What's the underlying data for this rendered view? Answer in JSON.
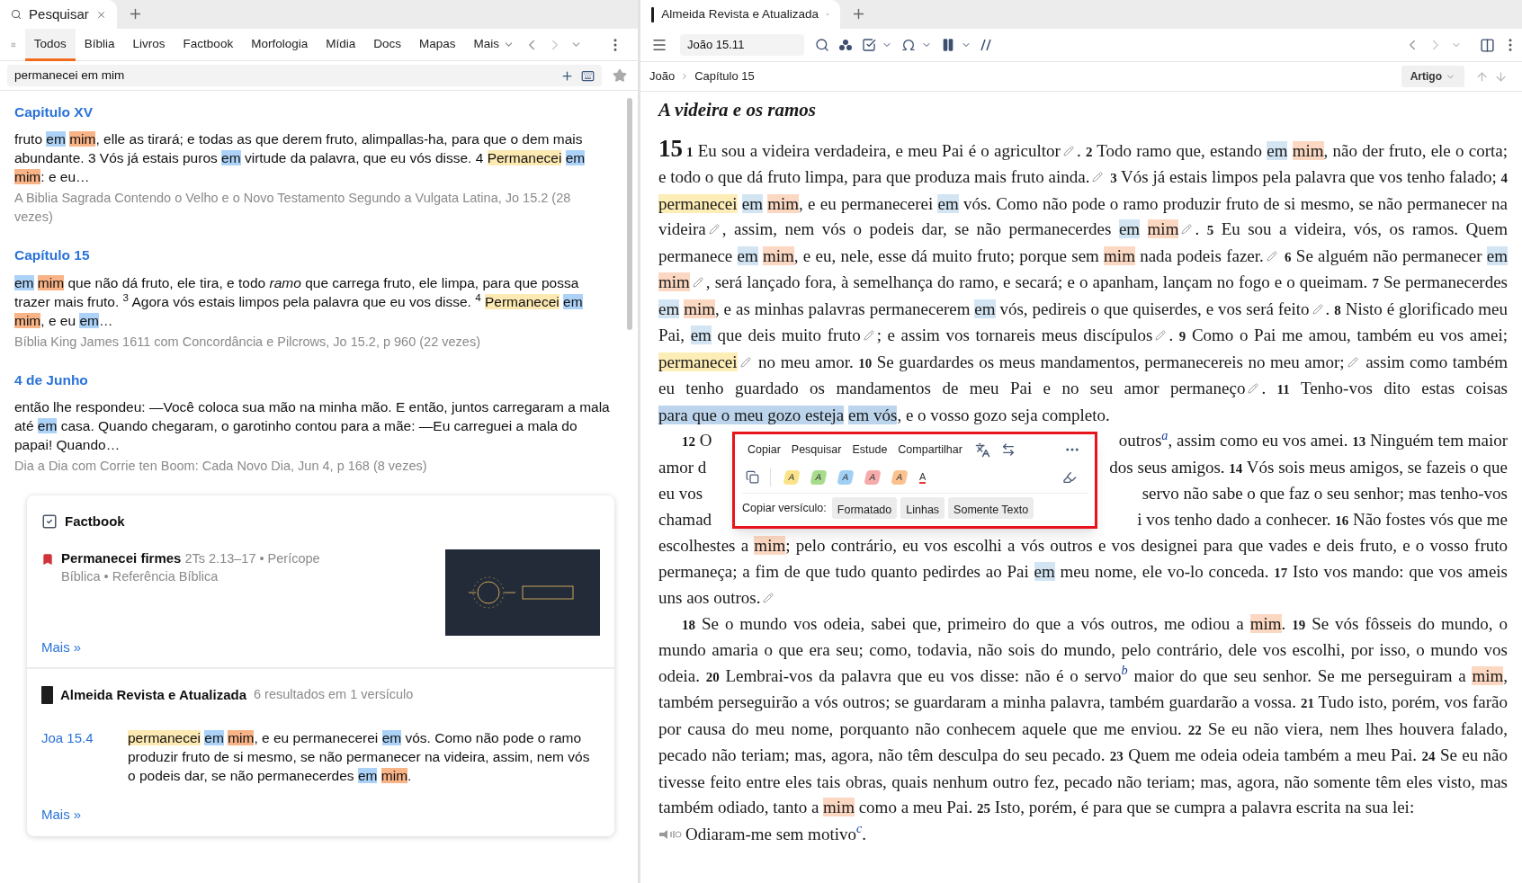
{
  "left_tab": {
    "label": "Pesquisar"
  },
  "search_tabs": [
    {
      "label": "Todos",
      "selected": true,
      "dropdown": false
    },
    {
      "label": "Bíblia",
      "selected": false,
      "dropdown": false
    },
    {
      "label": "Livros",
      "selected": false,
      "dropdown": false
    },
    {
      "label": "Factbook",
      "selected": false,
      "dropdown": false
    },
    {
      "label": "Morfologia",
      "selected": false,
      "dropdown": false
    },
    {
      "label": "Mídia",
      "selected": false,
      "dropdown": false
    },
    {
      "label": "Docs",
      "selected": false,
      "dropdown": false
    },
    {
      "label": "Mapas",
      "selected": false,
      "dropdown": false
    },
    {
      "label": "Mais",
      "selected": false,
      "dropdown": true
    }
  ],
  "query": "permanecei em mim",
  "results": [
    {
      "heading": "Capitulo XV",
      "segments": [
        {
          "kind": "text",
          "text": "fruto "
        },
        {
          "kind": "mark",
          "words": [
            {
              "text": "em",
              "color": "#acd2f8"
            },
            {
              "text": "mim",
              "color": "#f8b386"
            }
          ]
        },
        {
          "kind": "text",
          "text": ", elle as tirará; e todas as que derem fruto, alimpallas-ha, para que o dem mais abundante. 3 Vós já estais puros "
        },
        {
          "kind": "mark",
          "words": [
            {
              "text": "em",
              "color": "#acd2f8"
            }
          ]
        },
        {
          "kind": "text",
          "text": " virtude da palavra, que eu vós disse. 4 "
        },
        {
          "kind": "mark",
          "words": [
            {
              "text": "Permanecei",
              "color": "#fde9b2"
            },
            {
              "text": "em",
              "color": "#acd2f8"
            },
            {
              "text": "mim",
              "color": "#f8b386"
            }
          ]
        },
        {
          "kind": "text",
          "text": ": e eu…"
        }
      ],
      "source": "A Biblia Sagrada Contendo o Velho e o Novo Testamento Segundo a Vulgata Latina, Jo 15.2 (28 vezes)"
    },
    {
      "heading": "Capítulo 15",
      "segments": [
        {
          "kind": "mark",
          "words": [
            {
              "text": "em",
              "color": "#acd2f8"
            },
            {
              "text": "mim",
              "color": "#f8b386"
            }
          ]
        },
        {
          "kind": "text",
          "text": " que não dá fruto, ele tira, e todo *ramo* que carrega fruto, ele limpa, para que possa trazer mais fruto. $^{3}$ Agora vós estais limpos pela palavra que eu vos disse. $^{4}$ "
        },
        {
          "kind": "mark",
          "words": [
            {
              "text": "Permanecei",
              "color": "#fde9b2"
            },
            {
              "text": "em",
              "color": "#acd2f8"
            },
            {
              "text": "mim",
              "color": "#f8b386"
            }
          ]
        },
        {
          "kind": "text",
          "text": ", e eu "
        },
        {
          "kind": "mark",
          "words": [
            {
              "text": "em",
              "color": "#acd2f8"
            }
          ]
        },
        {
          "kind": "text",
          "text": "…"
        }
      ],
      "source": "Bíblia King James 1611 com Concordância e Pilcrows, Jo 15.2, p 960 (22 vezes)"
    },
    {
      "heading": "4 de Junho",
      "segments": [
        {
          "kind": "text",
          "text": "então lhe respondeu: —Você coloca sua mão na minha mão. E então, juntos carregaram a mala até "
        },
        {
          "kind": "mark",
          "words": [
            {
              "text": "em",
              "color": "#acd2f8"
            }
          ]
        },
        {
          "kind": "text",
          "text": " casa. Quando chegaram, o garotinho contou para a mãe: —Eu carreguei a mala do papai! Quando…"
        }
      ],
      "source": "Dia a Dia com Corrie ten Boom: Cada Novo Dia, Jun 4, p 168 (8 vezes)"
    }
  ],
  "factbook": {
    "title": "Factbook",
    "entry_title": "Permanecei firmes",
    "entry_meta": "2Ts 2.13–17 • Perícope Bíblica • Referência Bíblica",
    "more": "Mais »"
  },
  "bible_result": {
    "title": "Almeida Revista e Atualizada",
    "meta": "6 resultados em 1 versículo",
    "reference": "Joa 15.4",
    "segments": [
      {
        "kind": "mark",
        "words": [
          {
            "text": "permanecei",
            "color": "#fde9b2"
          },
          {
            "text": "em",
            "color": "#acd2f8"
          },
          {
            "text": "mim",
            "color": "#f8b386"
          }
        ]
      },
      {
        "kind": "text",
        "text": ", e eu permanecerei "
      },
      {
        "kind": "mark",
        "words": [
          {
            "text": "em",
            "color": "#acd2f8"
          }
        ]
      },
      {
        "kind": "text",
        "text": " vós. Como não pode o ramo produzir fruto de si mesmo, se não permanecer na videira, assim, nem vós o podeis dar, se não permanecerdes "
      },
      {
        "kind": "mark",
        "words": [
          {
            "text": "em",
            "color": "#acd2f8"
          },
          {
            "text": "mim",
            "color": "#f8b386"
          }
        ]
      },
      {
        "kind": "text",
        "text": "."
      }
    ],
    "more": "Mais »"
  },
  "right_tab": {
    "title": "Almeida Revista e Atualizada"
  },
  "reference_field": "João 15.11",
  "breadcrumb": [
    "João",
    "Capítulo 15"
  ],
  "view_button": "Artigo",
  "heading": "A videira e os ramos",
  "paragraph_1": [
    {
      "kind": "chapter",
      "text": "15"
    },
    {
      "kind": "text",
      "text": "**1** Eu sou a videira verdadeira, e meu Pai é o agricultor"
    },
    {
      "kind": "note"
    },
    {
      "kind": "text",
      "text": ". **2** Todo ramo que, estando "
    },
    {
      "kind": "mark",
      "words": [
        {
          "text": "em",
          "color": "#d3e5f3"
        },
        {
          "text": "mim",
          "color": "#fcd8c2"
        }
      ]
    },
    {
      "kind": "text",
      "text": ", não der fruto, ele o corta; e todo o que dá fruto limpa, para que produza mais fruto ainda."
    },
    {
      "kind": "note"
    },
    {
      "kind": "text",
      "text": " **3** Vós já estais limpos pela palavra que vos tenho falado; **4** "
    },
    {
      "kind": "mark",
      "words": [
        {
          "text": "permanecei",
          "color": "#fdedb6"
        },
        {
          "text": "em",
          "color": "#d3e5f3"
        },
        {
          "text": "mim",
          "color": "#fcd8c2"
        }
      ]
    },
    {
      "kind": "text",
      "text": ", e eu permanecerei "
    },
    {
      "kind": "mark",
      "words": [
        {
          "text": "em",
          "color": "#d3e5f3"
        }
      ]
    },
    {
      "kind": "text",
      "text": " vós. Como não pode o ramo produzir fruto de si mesmo, se não permanecer na videira"
    },
    {
      "kind": "note"
    },
    {
      "kind": "text",
      "text": ", assim, nem vós o podeis dar, se não permanecerdes "
    },
    {
      "kind": "mark",
      "words": [
        {
          "text": "em",
          "color": "#d3e5f3"
        },
        {
          "text": "mim",
          "color": "#fcd8c2"
        }
      ]
    },
    {
      "kind": "note"
    },
    {
      "kind": "text",
      "text": ". **5** Eu sou a videira, vós, os ramos. Quem permanece "
    },
    {
      "kind": "mark",
      "words": [
        {
          "text": "em",
          "color": "#d3e5f3"
        },
        {
          "text": "mim",
          "color": "#fcd8c2"
        }
      ]
    },
    {
      "kind": "text",
      "text": ", e eu, nele, esse dá muito fruto; porque sem "
    },
    {
      "kind": "mark",
      "words": [
        {
          "text": "mim",
          "color": "#fcd8c2"
        }
      ]
    },
    {
      "kind": "text",
      "text": " nada podeis fazer."
    },
    {
      "kind": "note"
    },
    {
      "kind": "text",
      "text": " **6** Se alguém não permanecer "
    },
    {
      "kind": "mark",
      "words": [
        {
          "text": "em",
          "color": "#d3e5f3"
        },
        {
          "text": "mim",
          "color": "#fcd8c2"
        }
      ]
    },
    {
      "kind": "note"
    },
    {
      "kind": "text",
      "text": ", será lançado fora, à semelhança do ramo, e secará; e o apanham, lançam no fogo e o queimam. **7** Se permanecerdes "
    },
    {
      "kind": "mark",
      "words": [
        {
          "text": "em",
          "color": "#d3e5f3"
        },
        {
          "text": "mim",
          "color": "#fcd8c2"
        }
      ]
    },
    {
      "kind": "text",
      "text": ", e as minhas palavras permanecerem "
    },
    {
      "kind": "mark",
      "words": [
        {
          "text": "em",
          "color": "#d3e5f3"
        }
      ]
    },
    {
      "kind": "text",
      "text": " vós, pedireis o que quiserdes, e vos será feito"
    },
    {
      "kind": "note"
    },
    {
      "kind": "text",
      "text": ". **8** Nisto é glorificado meu Pai, "
    },
    {
      "kind": "mark",
      "words": [
        {
          "text": "em",
          "color": "#d3e5f3"
        }
      ]
    },
    {
      "kind": "text",
      "text": " que deis muito fruto"
    },
    {
      "kind": "note"
    },
    {
      "kind": "text",
      "text": "; e assim vos tornareis meus discípulos"
    },
    {
      "kind": "note"
    },
    {
      "kind": "text",
      "text": ". **9** Como o Pai me amou, também eu vos amei; "
    },
    {
      "kind": "mark",
      "words": [
        {
          "text": "permanecei",
          "color": "#fdedb6"
        }
      ]
    },
    {
      "kind": "note"
    },
    {
      "kind": "text",
      "text": " no meu amor. **10** Se guardardes os meus mandamentos, permanecereis no meu amor;"
    },
    {
      "kind": "note"
    },
    {
      "kind": "text",
      "text": " assim como também eu tenho guardado os mandamentos de meu Pai e no seu amor permaneço"
    },
    {
      "kind": "note"
    },
    {
      "kind": "text",
      "text": ". **11** Tenho-vos dito estas coisas "
    },
    {
      "kind": "mark",
      "words": [
        {
          "text": "para que o meu gozo esteja",
          "color": "#bcd5ec"
        },
        {
          "text": "em vós",
          "color": "#bcd5ec"
        }
      ]
    },
    {
      "kind": "text",
      "text": ", e o vosso gozo seja completo."
    }
  ],
  "covered_lines": [
    {
      "left": "**12** O",
      "right": "outros$^{a}$, assim como eu vos amei. **13** Ninguém tem maior"
    },
    {
      "left": "amor d",
      "right": "dos seus amigos. **14** Vós sois meus amigos, se fazeis o que"
    },
    {
      "left": "eu vos",
      "right": "servo não sabe o que faz o seu senhor; mas tenho-vos"
    },
    {
      "left": "chamad",
      "right": "i vos tenho dado a conhecer. **16** Não fostes vós que me"
    }
  ],
  "paragraph_2": [
    {
      "kind": "text",
      "text": "escolhestes a "
    },
    {
      "kind": "mark",
      "words": [
        {
          "text": "mim",
          "color": "#fcd8c2"
        }
      ]
    },
    {
      "kind": "text",
      "text": "; pelo contrário, eu vos escolhi a vós outros e vos designei para que vades e deis fruto, e o vosso fruto permaneça; a fim de que tudo quanto pedirdes ao Pai "
    },
    {
      "kind": "mark",
      "words": [
        {
          "text": "em",
          "color": "#d3e5f3"
        }
      ]
    },
    {
      "kind": "text",
      "text": " meu nome, ele vo-lo conceda. **17** Isto vos mando: que vos ameis uns aos outros."
    },
    {
      "kind": "note"
    }
  ],
  "paragraph_3": [
    {
      "kind": "text",
      "text": "**18** Se o mundo vos odeia, sabei que, primeiro do que a vós outros, me odiou a "
    },
    {
      "kind": "mark",
      "words": [
        {
          "text": "mim",
          "color": "#fcd8c2"
        }
      ]
    },
    {
      "kind": "text",
      "text": ". **19** Se vós fôsseis do mundo, o mundo amaria o que era seu; como, todavia, não sois do mundo, pelo contrário, dele vos escolhi, por isso, o mundo vos odeia. **20** Lembrai-vos da palavra que eu vos disse: não é o servo$^{b}$ maior do que seu senhor. Se me perseguiram a "
    },
    {
      "kind": "mark",
      "words": [
        {
          "text": "mim",
          "color": "#fcd8c2"
        }
      ]
    },
    {
      "kind": "text",
      "text": ", também perseguirão a vós outros; se guardaram a minha palavra, também guardarão a vossa. **21** Tudo isto, porém, vos farão por causa do meu nome, porquanto não conhecem aquele que me enviou. **22** Se eu não viera, nem lhes houvera falado, pecado não teriam; mas, agora, não têm desculpa do seu pecado. **23** Quem me odeia odeia também a meu Pai. **24** Se eu não tivesse feito entre eles tais obras, quais nenhum outro fez, pecado não teriam; mas, agora, não somente têm eles visto, mas também odiado, tanto a "
    },
    {
      "kind": "mark",
      "words": [
        {
          "text": "mim",
          "color": "#fcd8c2"
        }
      ]
    },
    {
      "kind": "text",
      "text": " como a meu Pai. **25** Isto, porém, é para que se cumpra a palavra escrita na sua lei:"
    }
  ],
  "quote_line": "Odiaram-me sem motivo$^{c}$.",
  "popup": {
    "actions": [
      "Copiar",
      "Pesquisar",
      "Estude",
      "Compartilhar"
    ],
    "highlighters": [
      {
        "kind": "fill",
        "label": "A",
        "color": "#fbe38a"
      },
      {
        "kind": "fill",
        "label": "A",
        "color": "#a8dc8c"
      },
      {
        "kind": "fill",
        "label": "A",
        "color": "#a0d0f3"
      },
      {
        "kind": "fill",
        "label": "A",
        "color": "#f6abab"
      },
      {
        "kind": "fill",
        "label": "A",
        "color": "#fbc290"
      },
      {
        "kind": "underline",
        "label": "A",
        "color": "#e53935"
      }
    ],
    "copy_label": "Copiar versículo:",
    "copy_options": [
      "Formatado",
      "Linhas",
      "Somente Texto"
    ]
  }
}
